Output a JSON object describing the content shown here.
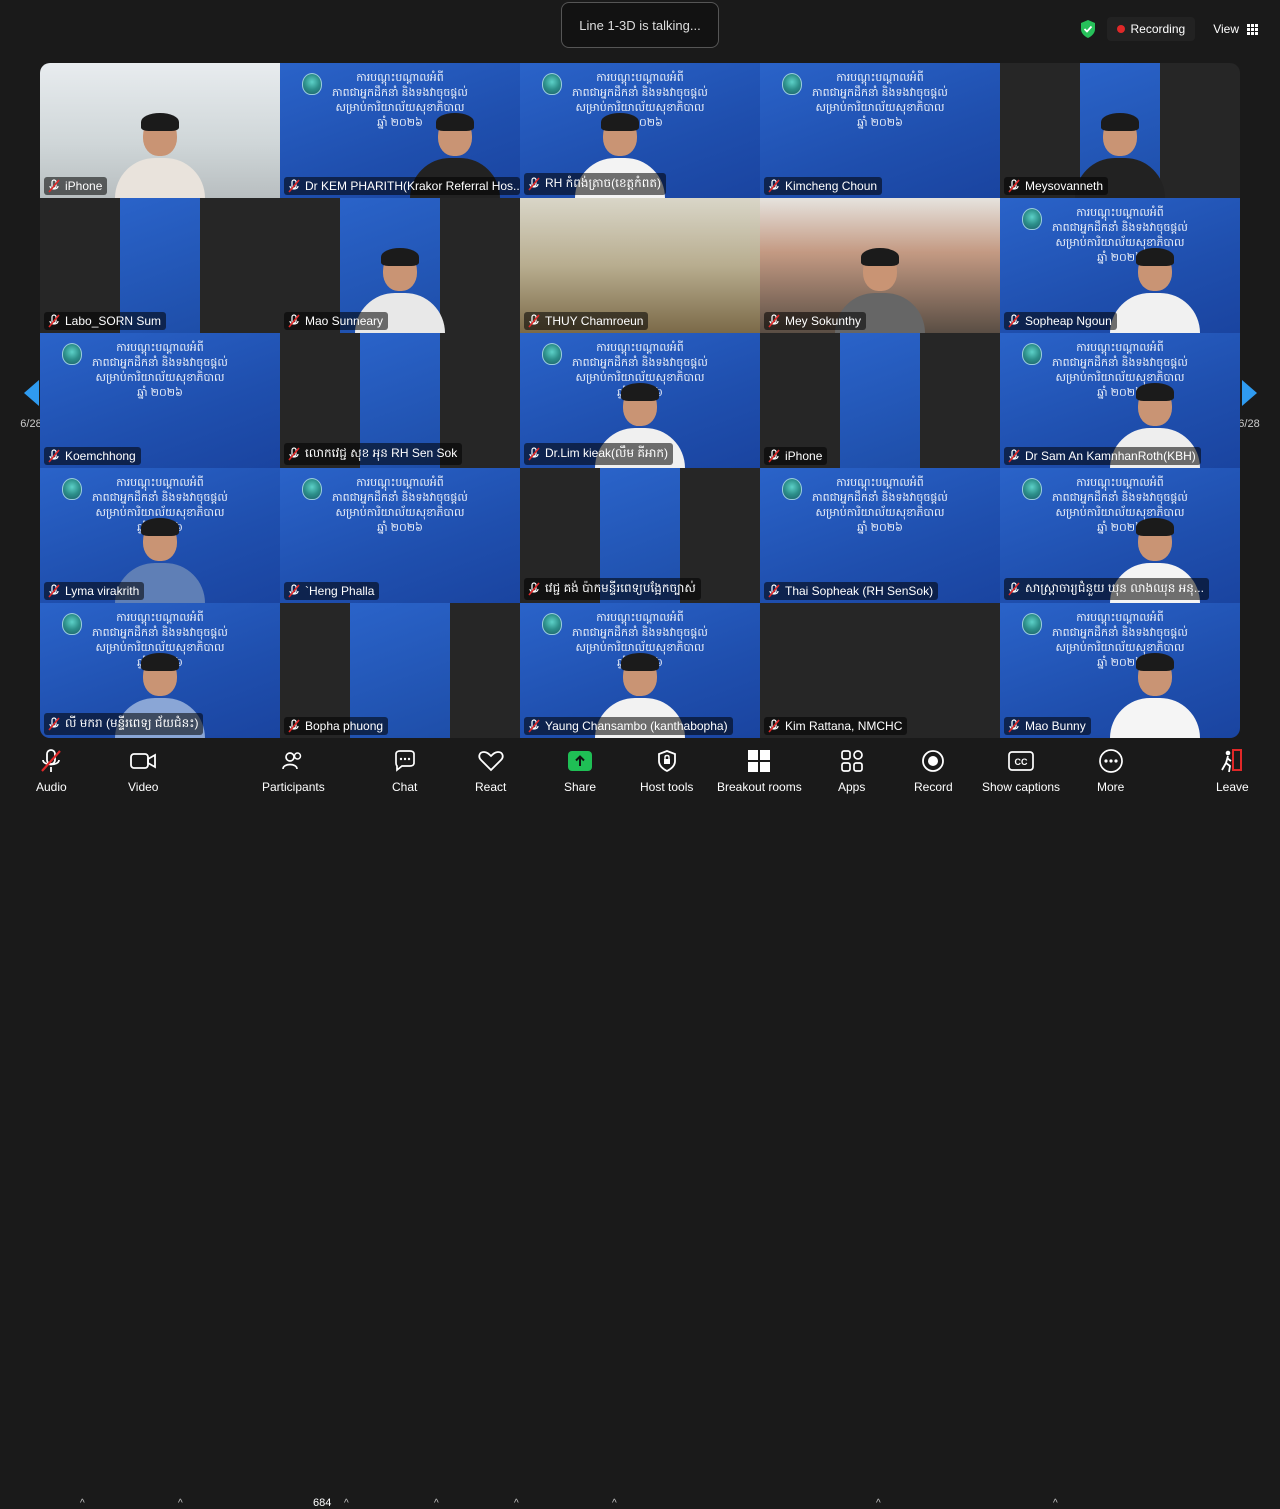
{
  "top": {
    "talking": "Line 1-3D is talking...",
    "recording": "Recording",
    "view": "View",
    "colors": {
      "recording_dot": "#e02828",
      "shield": "#27c15a"
    }
  },
  "banner": {
    "line1": "ការបណ្តុះបណ្តាលអំពី",
    "line2": "ភាពជាអ្នកដឹកនាំ និងទងវាចុចផ្តល់",
    "line3": "សម្រាប់ការិយាល័យសុខាភិបាល",
    "line4": "ឆ្នាំ ២០២៦"
  },
  "pagination": {
    "left": "6/28",
    "right": "6/28"
  },
  "participants": [
    {
      "name": "iPhone"
    },
    {
      "name": "Dr KEM PHARITH(Krakor Referral Hos..."
    },
    {
      "name": "RH កំពង់ត្រាច(ខេត្តកំពត)"
    },
    {
      "name": "Kimcheng Choun"
    },
    {
      "name": "Meysovanneth"
    },
    {
      "name": "Labo_SORN Sum"
    },
    {
      "name": "Mao Sunneary"
    },
    {
      "name": "THUY Chamroeun"
    },
    {
      "name": "Mey Sokunthy"
    },
    {
      "name": "Sopheap Ngoun"
    },
    {
      "name": "Koemchhong"
    },
    {
      "name": "លោកវេជ្ជ សុខ អុន RH Sen Sok"
    },
    {
      "name": "Dr.Lim kieak(លឹម គីអាក)"
    },
    {
      "name": "iPhone"
    },
    {
      "name": "Dr Sam An KamnhanRoth(KBH)"
    },
    {
      "name": "Lyma virakrith"
    },
    {
      "name": "`Heng Phalla"
    },
    {
      "name": "វេជ្ជ គង់ ប៉ាកមន្ទីរពេទ្យបង្អែកច្បាស់"
    },
    {
      "name": "Thai Sopheak (RH SenSok)"
    },
    {
      "name": "សាស្រ្តាចារ្យជំនួយ ឃុន លាងឈុន អនុ..."
    },
    {
      "name": "លី មករា (មន្ទីរពេទ្យ ជ័យជំនះ)"
    },
    {
      "name": "Bopha phuong"
    },
    {
      "name": "Yaung Chansambo (kanthabopha)"
    },
    {
      "name": "Kim Rattana, NMCHC"
    },
    {
      "name": "Mao Bunny"
    }
  ],
  "toolbar": {
    "audio": "Audio",
    "video": "Video",
    "participants": "Participants",
    "participant_count": "684",
    "chat": "Chat",
    "react": "React",
    "share": "Share",
    "host_tools": "Host tools",
    "breakout_rooms": "Breakout rooms",
    "apps": "Apps",
    "record": "Record",
    "show_captions": "Show captions",
    "more": "More",
    "leave": "Leave",
    "colors": {
      "share": "#1fbf55",
      "leave": "#e02828"
    }
  }
}
